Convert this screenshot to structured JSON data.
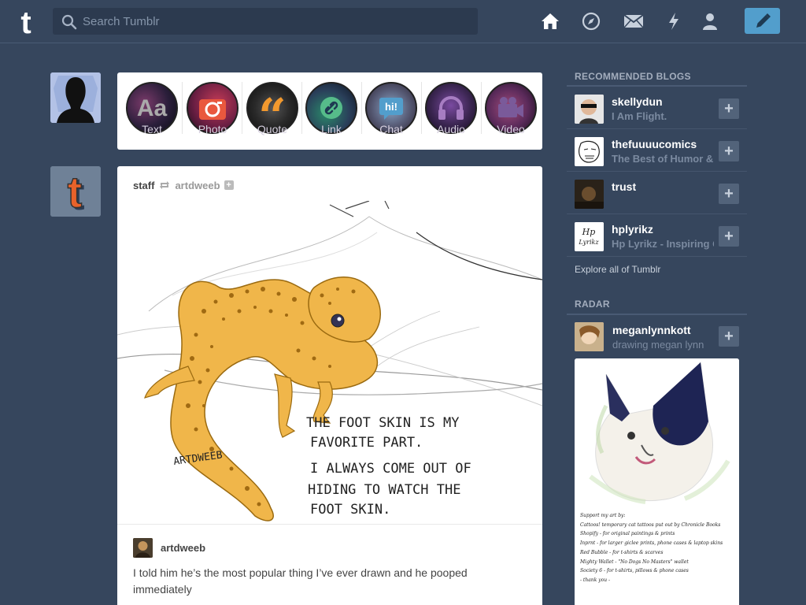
{
  "header": {
    "search_placeholder": "Search Tumblr",
    "nav": [
      "home-icon",
      "explore-compass-icon",
      "messages-envelope-icon",
      "activity-lightning-icon",
      "account-person-icon"
    ],
    "compose": "pencil-icon"
  },
  "post_types": [
    {
      "label": "Text",
      "icon": "text-icon"
    },
    {
      "label": "Photo",
      "icon": "camera-icon"
    },
    {
      "label": "Quote",
      "icon": "quote-icon"
    },
    {
      "label": "Link",
      "icon": "link-icon"
    },
    {
      "label": "Chat",
      "icon": "chat-icon"
    },
    {
      "label": "Audio",
      "icon": "headphones-icon"
    },
    {
      "label": "Video",
      "icon": "video-camera-icon"
    }
  ],
  "post": {
    "author": "staff",
    "reblogged_from": "artdweeb",
    "art": {
      "signature": "ARTDWEEB",
      "line1": "THE FOOT SKIN IS MY",
      "line2": "FAVORITE PART.",
      "line3": "I ALWAYS COME OUT OF",
      "line4": "HIDING TO WATCH THE",
      "line5": "FOOT SKIN."
    },
    "caption_author": "artdweeb",
    "caption": "I told him he’s the most popular thing I’ve ever drawn and he pooped immediately"
  },
  "sidebar": {
    "recommended_title": "RECOMMENDED BLOGS",
    "blogs": [
      {
        "name": "skellydun",
        "desc": "I Am Flight."
      },
      {
        "name": "thefuuuucomics",
        "desc": "The Best of Humor & Mor"
      },
      {
        "name": "trust",
        "desc": ""
      },
      {
        "name": "hplyrikz",
        "desc": "Hp Lyrikz - Inspiring Q"
      }
    ],
    "explore": "Explore all of Tumblr",
    "radar_title": "RADAR",
    "radar": {
      "name": "meganlynnkott",
      "desc": "drawing megan lynn",
      "lines": [
        "Support my art by:",
        "Cattoos! temporary cat tattoos put out by Chronicle Books",
        "Shopify - for original paintings & prints",
        "Inprnt - for larger giclee prints, phone cases & laptop skins",
        "Red Bubble - for t-shirts & scarves",
        "Mighty Wallet - \"No Dogs No Masters\" wallet",
        "Society 6 - for t-shirts, pillows & phone cases",
        "- thank you -"
      ]
    }
  },
  "colors": {
    "background": "#36465d",
    "accent": "#529ecc",
    "card": "#ffffff"
  }
}
